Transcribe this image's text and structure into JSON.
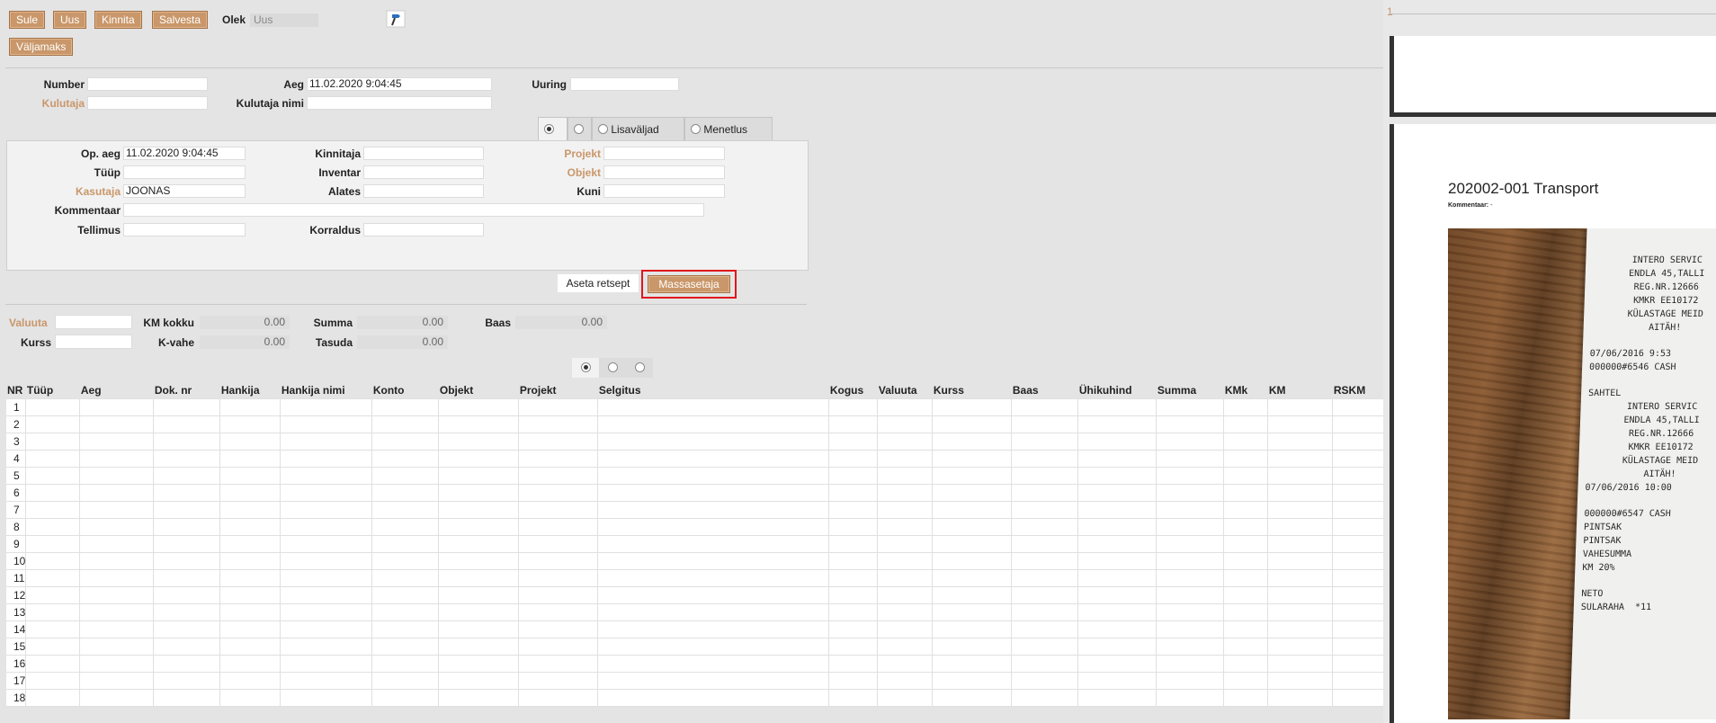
{
  "toolbar": {
    "close": "Sule",
    "new": "Uus",
    "confirm": "Kinnita",
    "save": "Salvesta",
    "state_label": "Olek",
    "state_value": "Uus",
    "payout": "Väljamaks"
  },
  "header": {
    "number_label": "Number",
    "number_value": "",
    "time_label": "Aeg",
    "time_value": "11.02.2020 9:04:45",
    "inquiry_label": "Uuring",
    "inquiry_value": "",
    "spender_label": "Kulutaja",
    "spender_value": "",
    "spender_name_label": "Kulutaja nimi",
    "spender_name_value": ""
  },
  "tabs": {
    "tab3": "Lisaväljad",
    "tab4": "Menetlus"
  },
  "panel": {
    "op_time_label": "Op. aeg",
    "op_time_value": "11.02.2020 9:04:45",
    "confirmer_label": "Kinnitaja",
    "project_label": "Projekt",
    "type_label": "Tüüp",
    "inventory_label": "Inventar",
    "object_label": "Objekt",
    "user_label": "Kasutaja",
    "user_value": "JOONAS",
    "from_label": "Alates",
    "until_label": "Kuni",
    "comment_label": "Kommentaar",
    "order_label": "Tellimus",
    "regulation_label": "Korraldus"
  },
  "actions": {
    "set_recipe": "Aseta retsept",
    "mass_setter": "Massasetaja"
  },
  "totals": {
    "currency_label": "Valuuta",
    "vat_total_label": "KM kokku",
    "vat_total_value": "0.00",
    "sum_label": "Summa",
    "sum_value": "0.00",
    "base_label": "Baas",
    "base_value": "0.00",
    "rate_label": "Kurss",
    "vat_diff_label": "K-vahe",
    "vat_diff_value": "0.00",
    "pay_label": "Tasuda",
    "pay_value": "0.00"
  },
  "grid": {
    "columns": [
      "NR",
      "Tüüp",
      "Aeg",
      "Dok. nr",
      "Hankija",
      "Hankija nimi",
      "Konto",
      "Objekt",
      "Projekt",
      "Selgitus",
      "Kogus",
      "Valuuta",
      "Kurss",
      "Baas",
      "Ühikuhind",
      "Summa",
      "KMk",
      "KM",
      "RSKM"
    ],
    "rows": [
      "1",
      "2",
      "3",
      "4",
      "5",
      "6",
      "7",
      "8",
      "9",
      "10",
      "11",
      "12",
      "13",
      "14",
      "15",
      "16",
      "17",
      "18"
    ]
  },
  "preview": {
    "page_number": "1",
    "title": "202002-001 Transport",
    "comment_label": "Kommentaar:",
    "comment_value": "-",
    "receipt_lines": [
      "INTERO SERVIC",
      "ENDLA 45,TALLI",
      "REG.NR.12666",
      "KMKR EE10172",
      "KÜLASTAGE MEID",
      "AITÄH!",
      "07/06/2016 9:53",
      "000000#6546 CASH",
      "SAHTEL",
      "INTERO SERVIC",
      "ENDLA 45,TALLI",
      "REG.NR.12666",
      "KMKR EE10172",
      "KÜLASTAGE MEID",
      "AITÄH!",
      "07/06/2016 10:00",
      "000000#6547 CASH",
      "PINTSAK",
      "PINTSAK",
      "VAHESUMMA",
      "KM 20%",
      "NETO",
      "SULARAHA  *11"
    ]
  }
}
